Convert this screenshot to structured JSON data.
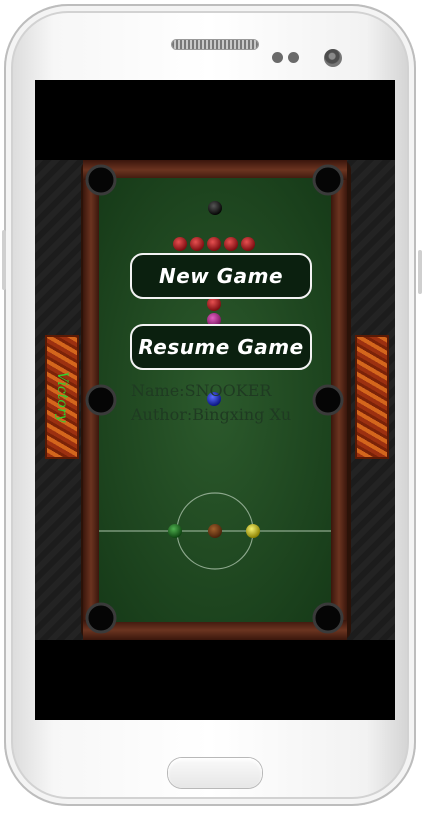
{
  "game": {
    "menu": {
      "new_game": "New Game",
      "resume_game": "Resume Game"
    },
    "info": {
      "name_line": "Name:SNOOKER",
      "author_line": "Author:Bingxing Xu"
    },
    "left_side_label": "Victory"
  },
  "colors": {
    "cloth": "#1e4a22",
    "cushion": "#5a2a1a",
    "button_bg": "#0b200f",
    "red_ball": "#b4171c"
  }
}
